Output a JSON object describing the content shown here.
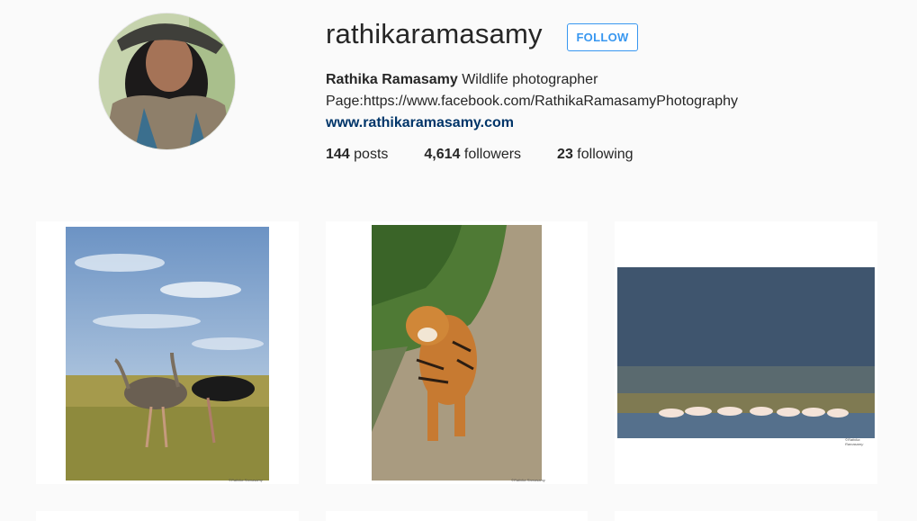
{
  "profile": {
    "username": "rathikaramasamy",
    "follow_label": "FOLLOW",
    "full_name": "Rathika Ramasamy",
    "bio_text": "Wildlife photographer",
    "bio_page": "Page:https://www.facebook.com/RathikaRamasamyPhotography",
    "website": "www.rathikaramasamy.com"
  },
  "stats": {
    "posts_count": "144",
    "posts_label": "posts",
    "followers_count": "4,614",
    "followers_label": "followers",
    "following_count": "23",
    "following_label": "following"
  },
  "posts": [
    {
      "subject": "ostriches",
      "credit": "©Rathika Ramasamy"
    },
    {
      "subject": "tiger",
      "credit": "©Rathika Ramasamy"
    },
    {
      "subject": "pelicans",
      "credit": "©Rathika Ramasamy"
    }
  ],
  "colors": {
    "accent": "#3897f0",
    "link": "#003569",
    "background": "#fafafa"
  }
}
